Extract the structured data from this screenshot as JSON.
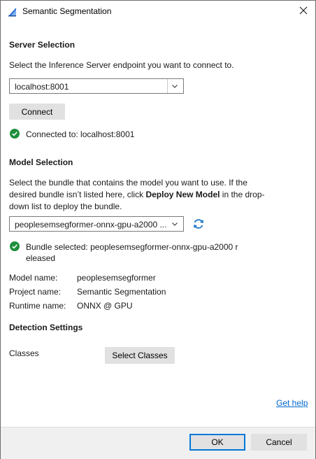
{
  "window": {
    "title": "Semantic Segmentation"
  },
  "server": {
    "heading": "Server Selection",
    "description": "Select the Inference Server endpoint you want to connect to.",
    "endpoint_value": "localhost:8001",
    "connect_label": "Connect",
    "status": "Connected to: localhost:8001"
  },
  "model": {
    "heading": "Model Selection",
    "description_prefix": "Select the bundle that contains the model you want to use. If the desired bundle isn’t listed here, click ",
    "description_bold": "Deploy New Model",
    "description_suffix": " in the drop-down list to deploy the bundle.",
    "bundle_value": "peoplesemsegformer-onnx-gpu-a2000 ...",
    "status_line1": "Bundle selected: peoplesemsegformer-onnx-gpu-a2000 r",
    "status_line2": "eleased",
    "info": {
      "model_name_label": "Model name:",
      "model_name_value": "peoplesemsegformer",
      "project_name_label": "Project name:",
      "project_name_value": "Semantic Segmentation",
      "runtime_name_label": "Runtime name:",
      "runtime_name_value": "ONNX @ GPU"
    }
  },
  "detection": {
    "heading": "Detection Settings",
    "classes_label": "Classes",
    "select_classes_label": "Select Classes"
  },
  "help_link": "Get help",
  "footer": {
    "ok_label": "OK",
    "cancel_label": "Cancel"
  },
  "colors": {
    "accent": "#0078d7",
    "success": "#1e8f3a",
    "link": "#0066cc",
    "refresh": "#1a73c8"
  },
  "icons": {
    "app": "app-icon",
    "close": "close-icon",
    "chevron": "chevron-down-icon",
    "refresh": "refresh-icon",
    "success": "check-circle-icon"
  }
}
